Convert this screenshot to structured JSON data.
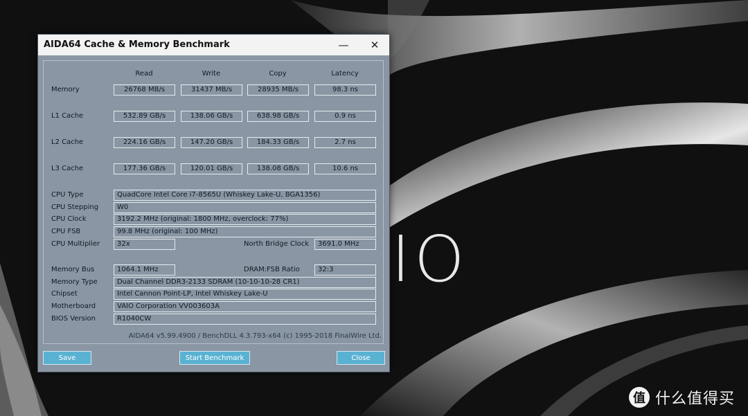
{
  "window": {
    "title": "AIDA64 Cache & Memory Benchmark",
    "minimize_glyph": "—",
    "close_glyph": "✕"
  },
  "columns": [
    "Read",
    "Write",
    "Copy",
    "Latency"
  ],
  "benchmark_rows": [
    {
      "label": "Memory",
      "read": "26768 MB/s",
      "write": "31437 MB/s",
      "copy": "28935 MB/s",
      "latency": "98.3 ns"
    },
    {
      "label": "L1 Cache",
      "read": "532.89 GB/s",
      "write": "138.06 GB/s",
      "copy": "638.98 GB/s",
      "latency": "0.9 ns"
    },
    {
      "label": "L2 Cache",
      "read": "224.16 GB/s",
      "write": "147.20 GB/s",
      "copy": "184.33 GB/s",
      "latency": "2.7 ns"
    },
    {
      "label": "L3 Cache",
      "read": "177.36 GB/s",
      "write": "120.01 GB/s",
      "copy": "138.08 GB/s",
      "latency": "10.6 ns"
    }
  ],
  "cpu_info": {
    "cpu_type_label": "CPU Type",
    "cpu_type": "QuadCore Intel Core i7-8565U  (Whiskey Lake-U, BGA1356)",
    "cpu_stepping_label": "CPU Stepping",
    "cpu_stepping": "W0",
    "cpu_clock_label": "CPU Clock",
    "cpu_clock": "3192.2 MHz  (original: 1800 MHz, overclock: 77%)",
    "cpu_fsb_label": "CPU FSB",
    "cpu_fsb": "99.8 MHz  (original: 100 MHz)",
    "cpu_multiplier_label": "CPU Multiplier",
    "cpu_multiplier": "32x",
    "north_bridge_clock_label": "North Bridge Clock",
    "north_bridge_clock": "3691.0 MHz"
  },
  "memory_info": {
    "memory_bus_label": "Memory Bus",
    "memory_bus": "1064.1 MHz",
    "dram_fsb_ratio_label": "DRAM:FSB Ratio",
    "dram_fsb_ratio": "32:3",
    "memory_type_label": "Memory Type",
    "memory_type": "Dual Channel DDR3-2133 SDRAM  (10-10-10-28 CR1)",
    "chipset_label": "Chipset",
    "chipset": "Intel Cannon Point-LP, Intel Whiskey Lake-U",
    "motherboard_label": "Motherboard",
    "motherboard": "VAIO Corporation VV003603A",
    "bios_version_label": "BIOS Version",
    "bios_version": "R1040CW"
  },
  "footer": {
    "version_text": "AIDA64 v5.99.4900 / BenchDLL 4.3.793-x64  (c) 1995-2018 FinalWire Ltd.",
    "save_label": "Save",
    "start_label": "Start Benchmark",
    "close_label": "Close"
  },
  "wallpaper": {
    "logo_text": "IO",
    "brand_icon": "值",
    "brand_text": "什么值得买"
  },
  "colors": {
    "window_bg": "#8a96a3",
    "button_bg": "#5ab2d3",
    "titlebar_bg": "#f3f3f3"
  }
}
